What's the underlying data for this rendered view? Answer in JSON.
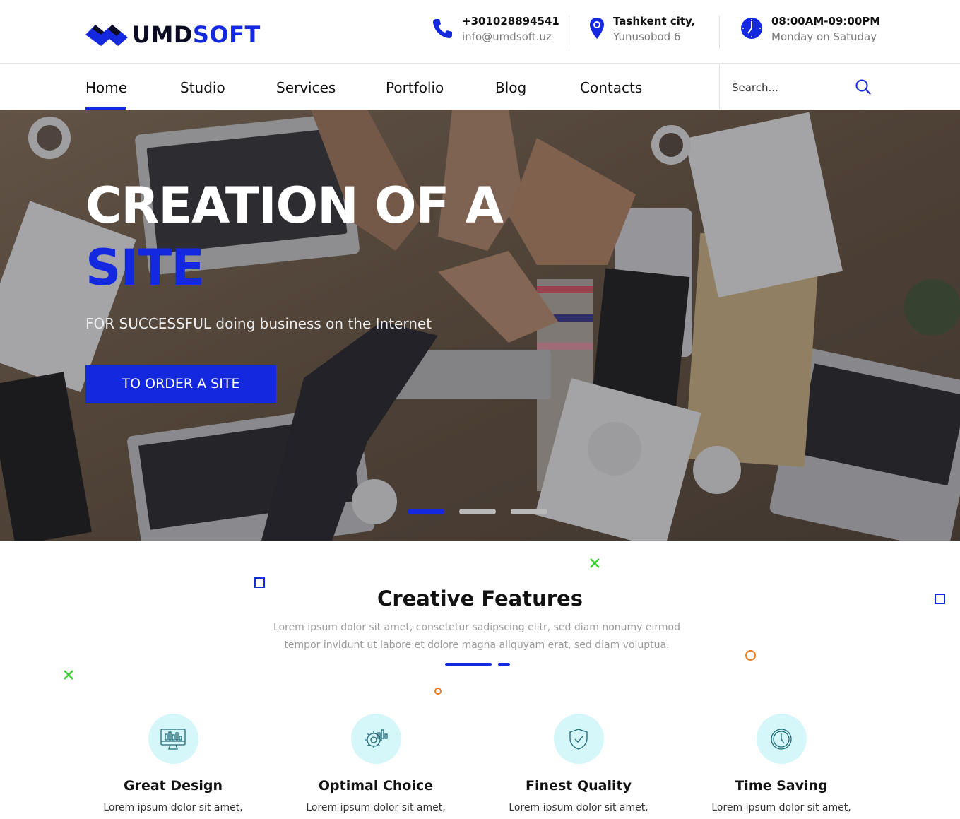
{
  "brand": {
    "part1": "UMD",
    "part2": "SOFT",
    "primary_color": "#1428e0",
    "dark_color": "#0b0b23"
  },
  "contact": {
    "phone": "+301028894541",
    "email": "info@umdsoft.uz",
    "city": "Tashkent city,",
    "street": "Yunusobod 6",
    "hours": "08:00AM-09:00PM",
    "days": "Monday on Satuday"
  },
  "nav": {
    "items": [
      {
        "label": "Home",
        "active": true
      },
      {
        "label": "Studio"
      },
      {
        "label": "Services"
      },
      {
        "label": "Portfolio"
      },
      {
        "label": "Blog"
      },
      {
        "label": "Contacts"
      }
    ],
    "search_placeholder": "Search..."
  },
  "hero": {
    "title_line1": "CREATION OF A",
    "title_line2": "SITE",
    "subtitle": "FOR SUCCESSFUL doing business on the Internet",
    "button_label": "TO ORDER A SITE",
    "slides": 3,
    "active_slide": 1
  },
  "features": {
    "title": "Creative Features",
    "description": "Lorem ipsum dolor sit amet, consetetur sadipscing elitr, sed diam nonumy eirmod tempor invidunt ut labore et dolore magna aliquyam erat, sed diam voluptua.",
    "items": [
      {
        "title": "Great Design",
        "text": "Lorem ipsum dolor sit amet,",
        "icon": "monitor-chart-icon"
      },
      {
        "title": "Optimal Choice",
        "text": "Lorem ipsum dolor sit amet,",
        "icon": "gear-chart-icon"
      },
      {
        "title": "Finest Quality",
        "text": "Lorem ipsum dolor sit amet,",
        "icon": "shield-check-icon"
      },
      {
        "title": "Time Saving",
        "text": "Lorem ipsum dolor sit amet,",
        "icon": "clock-icon"
      }
    ]
  }
}
